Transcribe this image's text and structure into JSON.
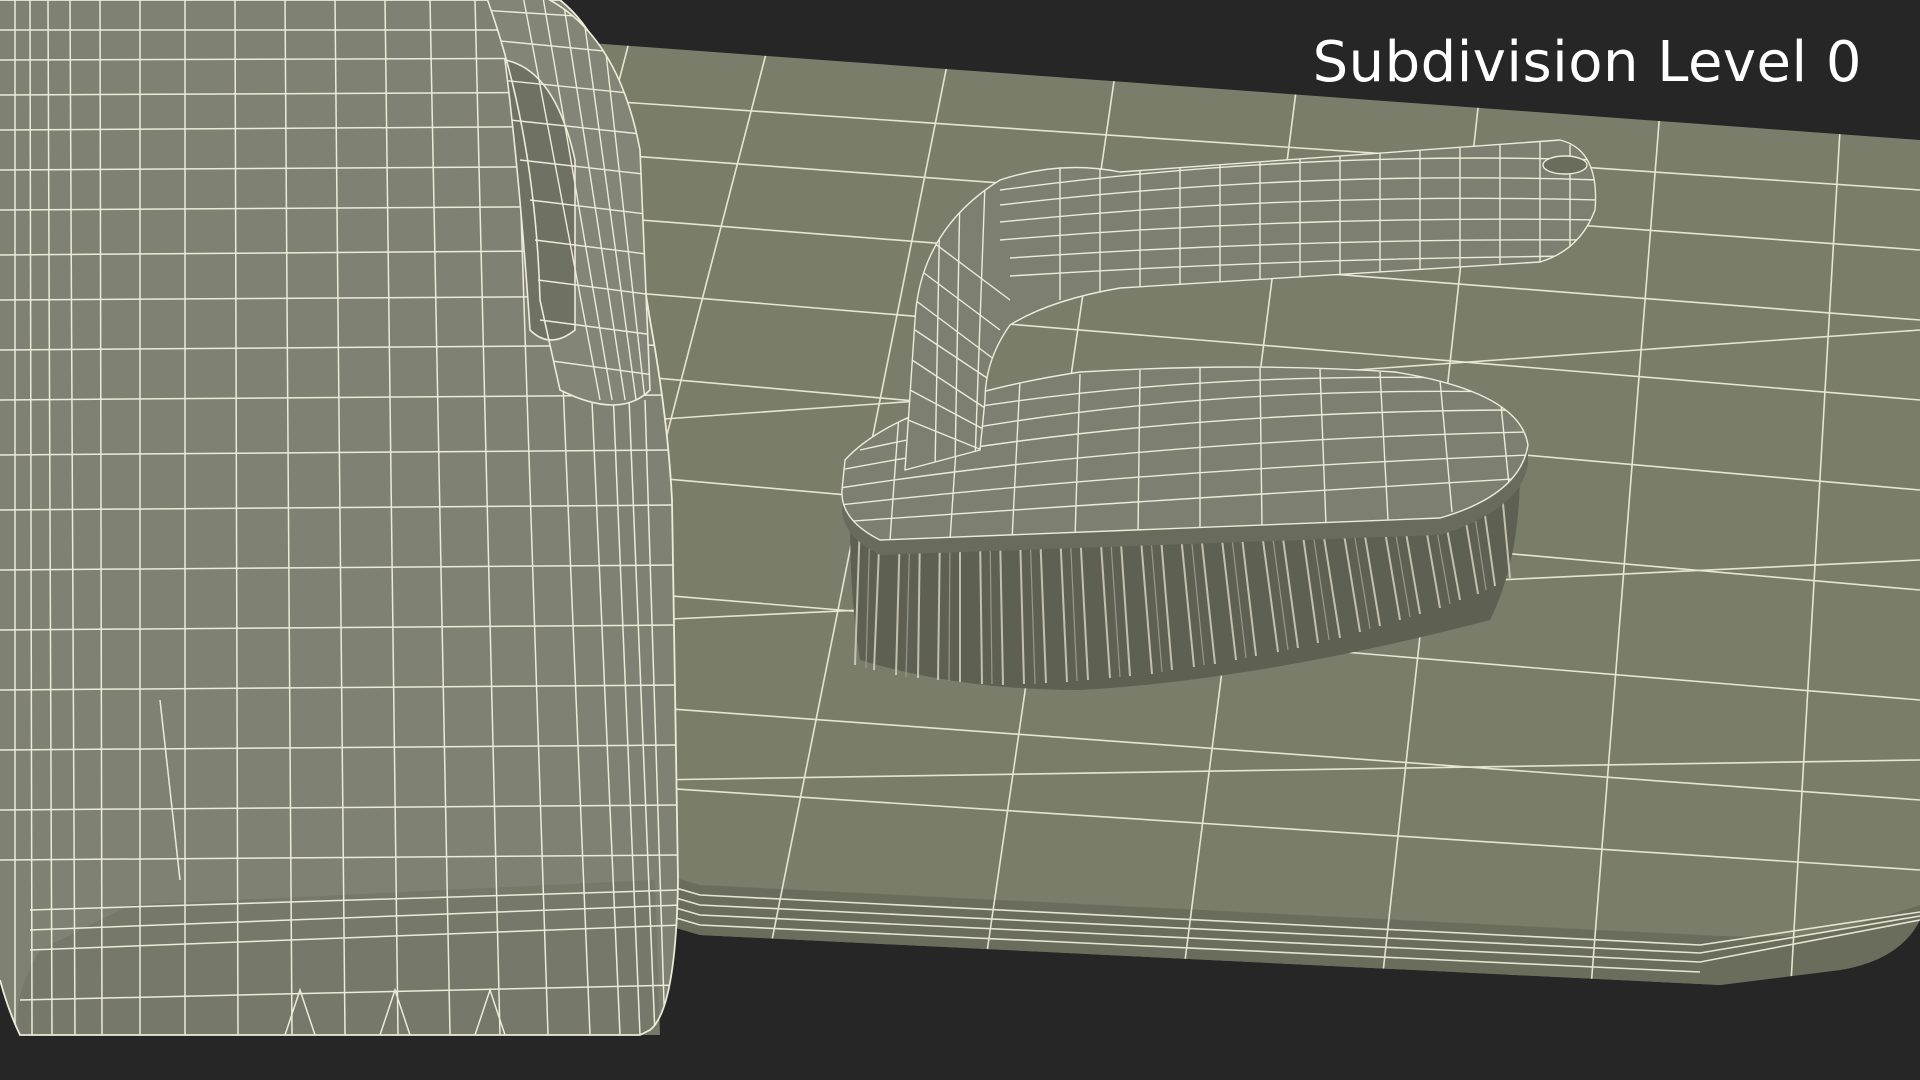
{
  "overlay": {
    "label": "Subdivision Level 0"
  },
  "colors": {
    "background": "#252625",
    "surface": "#7a7d6a",
    "surface_shadow": "#6c6f5e",
    "surface_dark": "#5f6253",
    "wire": "#ecebd8",
    "bristle": "#c9c6b4"
  }
}
